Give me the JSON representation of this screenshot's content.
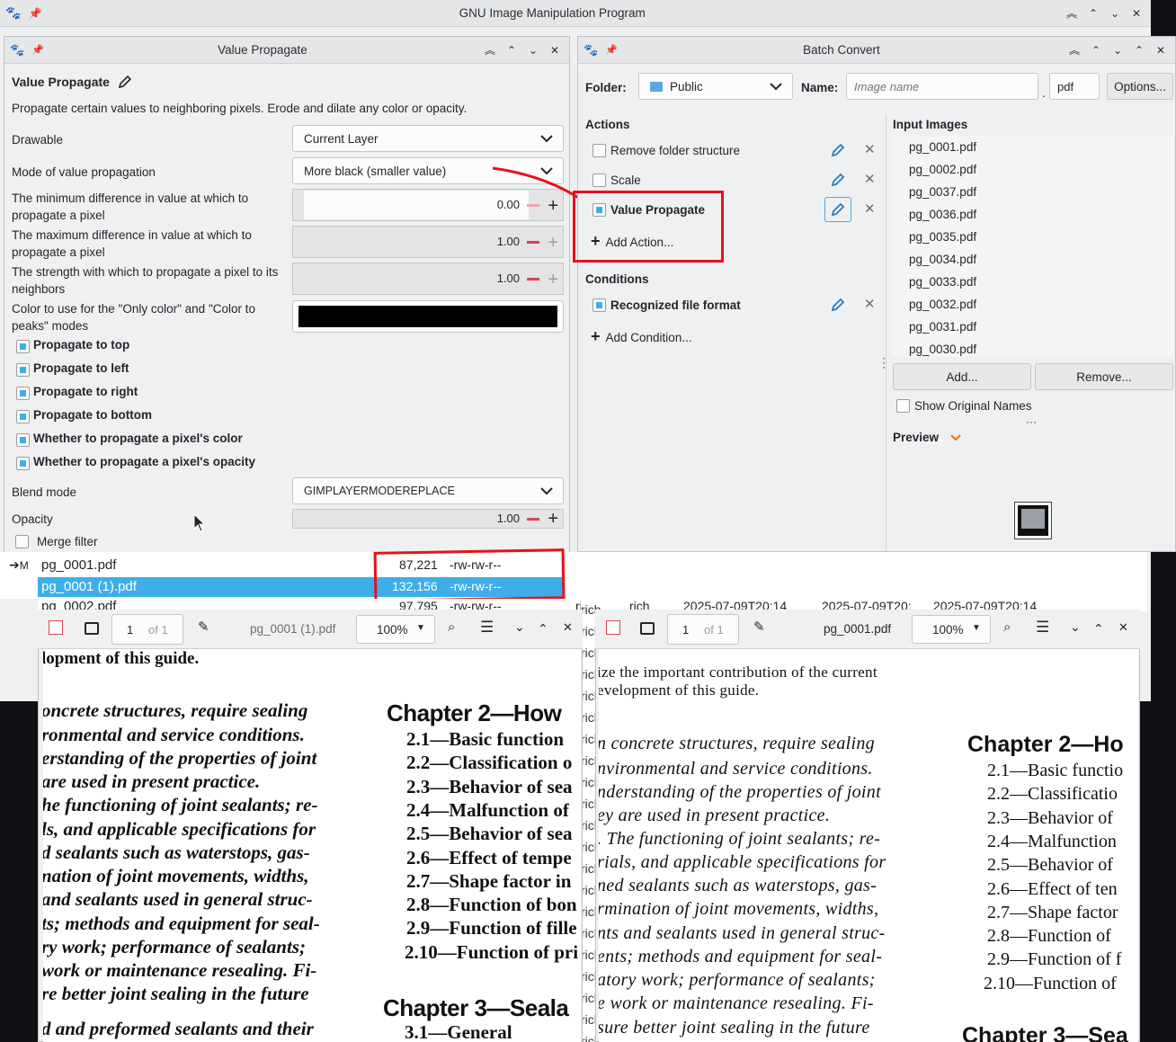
{
  "main_window": {
    "title": "GNU Image Manipulation Program"
  },
  "value_propagate": {
    "window_title": "Value Propagate",
    "heading": "Value Propagate",
    "description": "Propagate certain values to neighboring pixels. Erode and dilate any color or opacity.",
    "drawable_label": "Drawable",
    "drawable_value": "Current Layer",
    "mode_label": "Mode of value propagation",
    "mode_value": "More black (smaller value)",
    "min_diff_label_1": "The minimum difference in value at which to",
    "min_diff_label_2": "propagate a pixel",
    "min_diff_value": "0.00",
    "max_diff_label_1": "The maximum difference in value at which to",
    "max_diff_label_2": "propagate a pixel",
    "max_diff_value": "1.00",
    "strength_label_1": "The strength with which to propagate a pixel to its",
    "strength_label_2": "neighbors",
    "strength_value": "1.00",
    "color_label_1": "Color to use for the \"Only color\" and \"Color to",
    "color_label_2": "peaks\" modes",
    "color_value": "#000000",
    "checks": [
      {
        "label": "Propagate to top",
        "checked": true
      },
      {
        "label": "Propagate to left",
        "checked": true
      },
      {
        "label": "Propagate to right",
        "checked": true
      },
      {
        "label": "Propagate to bottom",
        "checked": true
      },
      {
        "label": "Whether to propagate a pixel's color",
        "checked": true
      },
      {
        "label": "Whether to propagate a pixel's opacity",
        "checked": true
      }
    ],
    "blend_label": "Blend mode",
    "blend_value": "GIMPLAYERMODEREPLACE",
    "opacity_label": "Opacity",
    "opacity_value": "1.00",
    "merge_label": "Merge filter"
  },
  "batch_convert": {
    "window_title": "Batch Convert",
    "folder_label": "Folder:",
    "folder_value": "Public",
    "name_label": "Name:",
    "name_placeholder": "Image name",
    "dot": ".",
    "extension": "pdf",
    "options_button": "Options...",
    "actions_heading": "Actions",
    "actions": [
      {
        "label": "Remove folder structure",
        "checked": false
      },
      {
        "label": "Scale",
        "checked": false
      },
      {
        "label": "Value Propagate",
        "checked": true
      }
    ],
    "add_action": "Add Action...",
    "conditions_heading": "Conditions",
    "conditions": [
      {
        "label": "Recognized file format",
        "checked": true
      }
    ],
    "add_condition": "Add Condition...",
    "input_images_heading": "Input Images",
    "input_images": [
      "pg_0001.pdf",
      "pg_0002.pdf",
      "pg_0037.pdf",
      "pg_0036.pdf",
      "pg_0035.pdf",
      "pg_0034.pdf",
      "pg_0033.pdf",
      "pg_0032.pdf",
      "pg_0031.pdf",
      "pg_0030.pdf"
    ],
    "add_button": "Add...",
    "remove_button": "Remove...",
    "show_original_names": "Show Original Names",
    "preview_label": "Preview"
  },
  "file_list": {
    "arrow_prefix": "M",
    "rows": [
      {
        "name": "pg_0001.pdf",
        "size": "87,221",
        "perm": "-rw-rw-r--"
      },
      {
        "name": "pg_0001 (1).pdf",
        "size": "132,156",
        "perm": "-rw-rw-r--"
      },
      {
        "name": "pg_0002.pdf",
        "size": "97,795",
        "perm": "-rw-rw-r--"
      }
    ],
    "owner": "rich",
    "group": "rich",
    "date1": "2025-07-09T20:14",
    "date2": "2025-07-09T20:",
    "date3": "2025-07-09T20:14"
  },
  "viewer_left": {
    "page_number": "1",
    "page_of": "of 1",
    "filename": "pg_0001 (1).pdf",
    "zoom": "100%"
  },
  "viewer_right": {
    "page_number": "1",
    "page_of": "of 1",
    "filename": "pg_0001.pdf",
    "zoom": "100%"
  },
  "doc_left": {
    "lines_left": [
      "lopment of this guide.",
      "oncrete structures, require sealing",
      "ronmental and service conditions.",
      "erstanding of the properties of joint",
      " are used in present practice.",
      "he functioning of joint sealants; re-",
      "ls, and applicable specifications for",
      "d sealants such as waterstops, gas-",
      "nation of joint movements, widths,",
      "and sealants used in general struc-",
      "ts; methods and equipment for seal-",
      "ry work; performance of sealants;",
      "work or maintenance resealing. Fi-",
      "re better joint sealing in the future",
      "d and preformed sealants and their"
    ],
    "chapter2": "Chapter 2—How",
    "toc": [
      "2.1—Basic function",
      "2.2—Classification o",
      "2.3—Behavior of sea",
      "2.4—Malfunction of",
      "2.5—Behavior of sea",
      "2.6—Effect of tempe",
      "2.7—Shape factor in",
      "2.8—Function of bon",
      "2.9—Function of fille",
      "2.10—Function of pri"
    ],
    "chapter3": "Chapter 3—Seala",
    "ch3_item": "3.1—General"
  },
  "doc_right": {
    "lines_left": [
      "ize the important contribution of the current",
      "evelopment of this guide.",
      "n concrete structures, require sealing",
      "nvironmental and service conditions.",
      "nderstanding of the properties of joint",
      "ey are used in present practice.",
      ". The functioning of joint sealants; re-",
      "rials, and applicable specifications for",
      "ned sealants such as waterstops, gas-",
      "rmination of joint movements, widths,",
      "nts and sealants used in general struc-",
      "ents; methods and equipment for seal-",
      "atory work; performance of sealants;",
      "e work or maintenance resealing. Fi-",
      "sure better joint sealing in the future"
    ],
    "chapter2": "Chapter 2—Ho",
    "toc": [
      "2.1—Basic functio",
      "2.2—Classificatio",
      "2.3—Behavior of",
      "2.4—Malfunction",
      "2.5—Behavior of",
      "2.6—Effect of ten",
      "2.7—Shape factor",
      "2.8—Function of",
      "2.9—Function of f",
      "2.10—Function of"
    ],
    "chapter3": "Chapter 3—Sea"
  }
}
